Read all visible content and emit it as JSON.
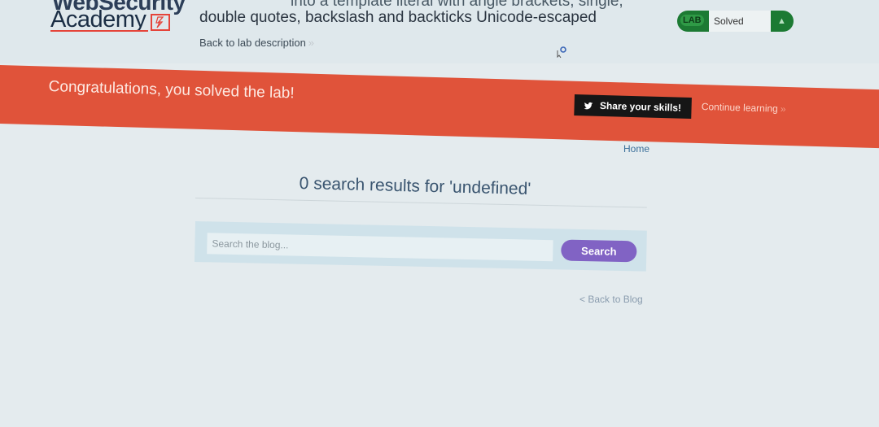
{
  "header": {
    "logo_line1": "WebSecurity",
    "logo_line2": "Academy",
    "lab_title_line1": "into a template literal with angle brackets, single,",
    "lab_title_line2": "double quotes, backslash and backticks Unicode-escaped",
    "back_to_description": "Back to lab description",
    "back_chevron": "»",
    "lab_badge": "LAB",
    "lab_status": "Solved",
    "status_icon": "flask-icon"
  },
  "banner": {
    "message": "Congratulations, you solved the lab!",
    "share_label": "Share your skills!",
    "share_icon": "twitter-bird-icon",
    "continue_label": "Continue learning",
    "continue_chevron": "»",
    "background_color": "#e0533a"
  },
  "nav": {
    "home": "Home"
  },
  "main": {
    "results_title": "0 search results for 'undefined'",
    "search_placeholder": "Search the blog...",
    "search_button": "Search",
    "back_to_blog": "< Back to Blog"
  },
  "colors": {
    "accent_button": "#8163c4",
    "solved_green": "#1c7a33"
  }
}
